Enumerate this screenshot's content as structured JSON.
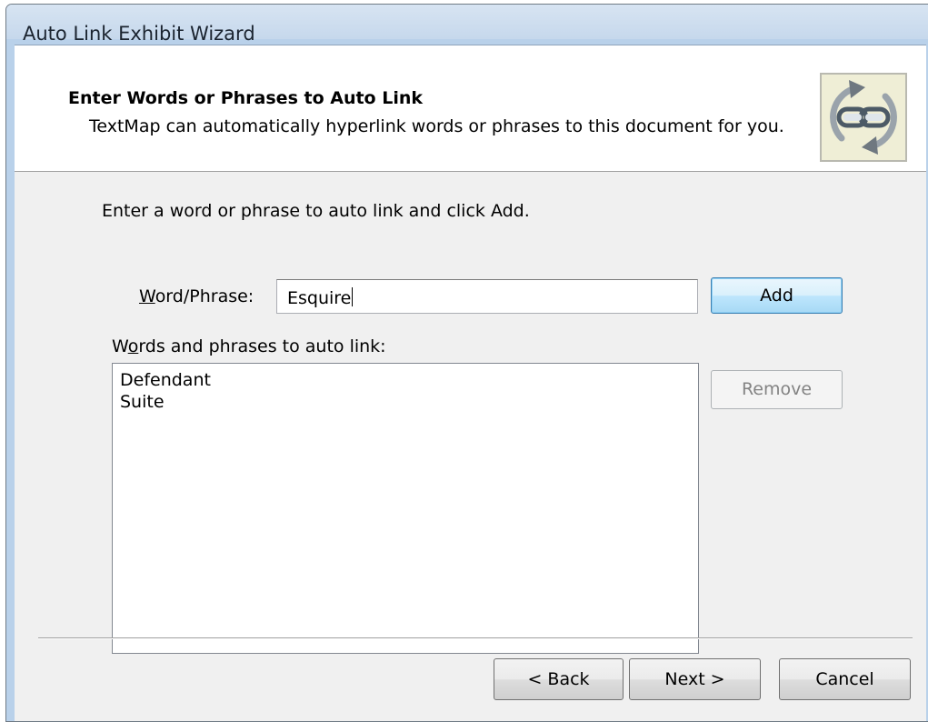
{
  "window": {
    "title": "Auto Link Exhibit Wizard"
  },
  "header": {
    "title": "Enter Words or Phrases to Auto Link",
    "description": "TextMap can automatically hyperlink words or phrases to this document for you.",
    "logo_icon": "chain-link-refresh-icon"
  },
  "instructions": "Enter a word or phrase to auto link and click Add.",
  "word_field": {
    "label_mnemonic": "W",
    "label_rest": "ord/Phrase:",
    "value": "Esquire"
  },
  "add_button": {
    "label": "Add"
  },
  "list": {
    "label_pre": "W",
    "label_mnemonic": "o",
    "label_rest": "rds and phrases to auto link:",
    "items": [
      "Defendant",
      "Suite"
    ]
  },
  "remove_button": {
    "label": "Remove",
    "enabled": false
  },
  "footer": {
    "back_label": "< Back",
    "next_label": "Next >",
    "cancel_label": "Cancel"
  },
  "colors": {
    "title_bar": "#c6d8ec",
    "dialog_bg": "#f0f0f0",
    "add_button_accent": "#3c7fb1",
    "logo_bg": "#efeed6"
  }
}
